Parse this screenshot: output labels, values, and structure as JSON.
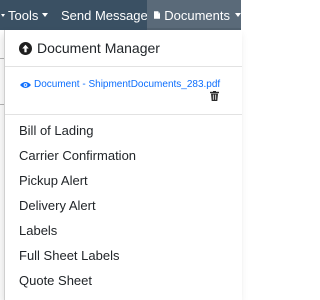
{
  "toolbar": {
    "tools_label": "Tools",
    "send_message_label": "Send Message",
    "documents_label": "Documents"
  },
  "dropdown": {
    "title": "Document Manager",
    "document_link": "Document - ShipmentDocuments_283.pdf",
    "items": [
      "Bill of Lading",
      "Carrier Confirmation",
      "Pickup Alert",
      "Delivery Alert",
      "Labels",
      "Full Sheet Labels",
      "Quote Sheet"
    ]
  },
  "colors": {
    "toolbar_bg": "#3a5063",
    "active_tab_bg": "#5a6a79",
    "link": "#0d6efd",
    "text": "#212529"
  },
  "icons": {
    "tools_caret": "caret-down-icon",
    "send_message": "envelope-icon",
    "documents": "file-icon",
    "documents_caret": "caret-down-icon",
    "title": "arrow-circle-up-icon",
    "document_link": "eye-icon",
    "delete": "trash-icon"
  }
}
